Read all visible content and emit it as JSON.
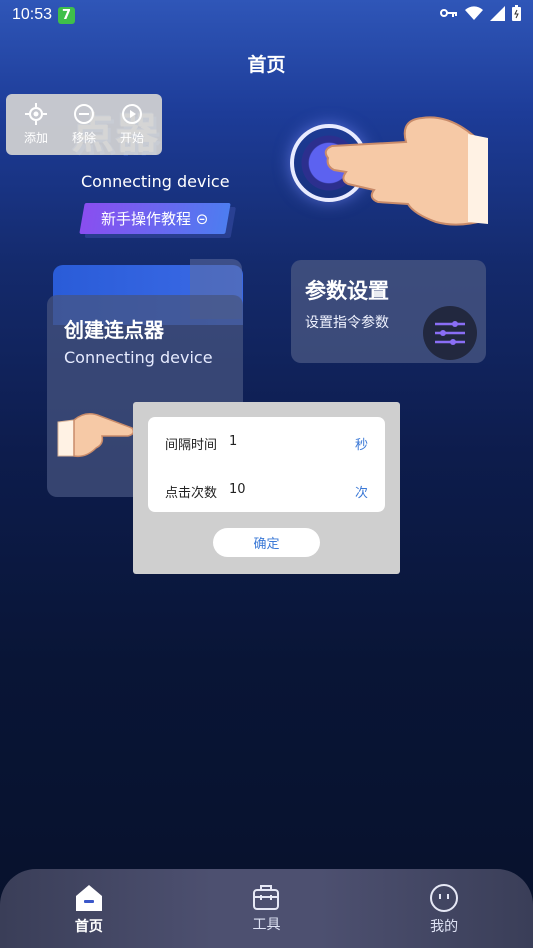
{
  "status_bar": {
    "time": "10:53",
    "badge": "7"
  },
  "header": {
    "title": "首页"
  },
  "hero": {
    "title_visible": "点器",
    "subtitle": "Connecting device",
    "tutorial_label": "新手操作教程 ⊝"
  },
  "float_toolbar": {
    "items": [
      {
        "label": "添加",
        "icon": "crosshair-icon"
      },
      {
        "label": "移除",
        "icon": "minus-circle-icon"
      },
      {
        "label": "开始",
        "icon": "play-circle-icon"
      }
    ]
  },
  "cards": {
    "create": {
      "title": "创建连点器",
      "subtitle": "Connecting device"
    },
    "params": {
      "title": "参数设置",
      "subtitle": "设置指令参数",
      "icon": "sliders-icon"
    }
  },
  "dialog": {
    "rows": [
      {
        "label": "间隔时间",
        "value": "1",
        "unit": "秒"
      },
      {
        "label": "点击次数",
        "value": "10",
        "unit": "次"
      }
    ],
    "confirm_label": "确定"
  },
  "bottom_nav": {
    "items": [
      {
        "label": "首页",
        "icon": "home-icon",
        "active": true
      },
      {
        "label": "工具",
        "icon": "toolbox-icon",
        "active": false
      },
      {
        "label": "我的",
        "icon": "profile-icon",
        "active": false
      }
    ]
  },
  "colors": {
    "accent": "#3a78d6",
    "tutorial_gradient_start": "#8a4ef0",
    "tutorial_gradient_end": "#4d7df0"
  }
}
